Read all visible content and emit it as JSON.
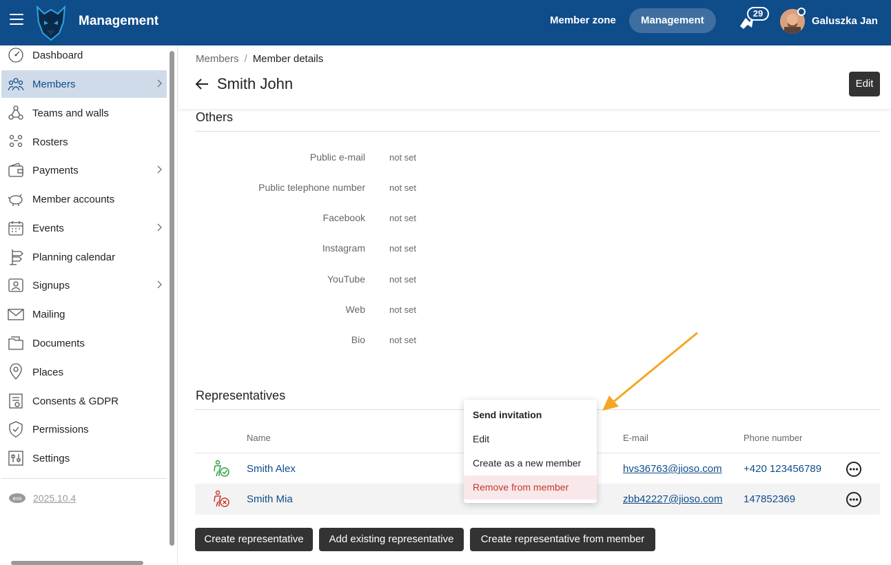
{
  "header": {
    "app_title": "Management",
    "nav": {
      "member_zone": "Member zone",
      "management": "Management"
    },
    "notification_count": "29",
    "user_name": "Galuszka Jan"
  },
  "sidebar": {
    "items": [
      {
        "label": "Dashboard",
        "icon": "dashboard-icon"
      },
      {
        "label": "Members",
        "icon": "members-icon",
        "active": true,
        "has_children": true
      },
      {
        "label": "Teams and walls",
        "icon": "teams-icon"
      },
      {
        "label": "Rosters",
        "icon": "rosters-icon"
      },
      {
        "label": "Payments",
        "icon": "payments-icon",
        "has_children": true
      },
      {
        "label": "Member accounts",
        "icon": "piggy-bank-icon"
      },
      {
        "label": "Events",
        "icon": "calendar-icon",
        "has_children": true
      },
      {
        "label": "Planning calendar",
        "icon": "signpost-icon"
      },
      {
        "label": "Signups",
        "icon": "signup-icon",
        "has_children": true
      },
      {
        "label": "Mailing",
        "icon": "mail-icon"
      },
      {
        "label": "Documents",
        "icon": "folder-icon"
      },
      {
        "label": "Places",
        "icon": "location-icon"
      },
      {
        "label": "Consents & GDPR",
        "icon": "consent-icon"
      },
      {
        "label": "Permissions",
        "icon": "shield-icon"
      },
      {
        "label": "Settings",
        "icon": "settings-icon"
      }
    ],
    "version_badge": "eos",
    "version": "2025.10.4"
  },
  "page": {
    "breadcrumb": {
      "parent": "Members",
      "separator": "/",
      "current": "Member details"
    },
    "title": "Smith John",
    "edit_label": "Edit"
  },
  "others": {
    "title": "Others",
    "fields": [
      {
        "label": "Public e-mail",
        "value": "not set"
      },
      {
        "label": "Public telephone number",
        "value": "not set"
      },
      {
        "label": "Facebook",
        "value": "not set"
      },
      {
        "label": "Instagram",
        "value": "not set"
      },
      {
        "label": "YouTube",
        "value": "not set"
      },
      {
        "label": "Web",
        "value": "not set"
      },
      {
        "label": "Bio",
        "value": "not set"
      }
    ]
  },
  "representatives": {
    "title": "Representatives",
    "columns": {
      "name": "Name",
      "email": "E-mail",
      "phone": "Phone number"
    },
    "rows": [
      {
        "name": "Smith Alex",
        "email": "hvs36763@jioso.com",
        "phone": "+420 123456789",
        "status": "accepted",
        "status_color": "#2e9e44"
      },
      {
        "name": "Smith Mia",
        "email": "zbb42227@jioso.com",
        "phone": "147852369",
        "status": "rejected",
        "status_color": "#c0392b"
      }
    ],
    "menu": [
      "Send invitation",
      "Edit",
      "Create as a new member",
      "Remove from member"
    ],
    "buttons": [
      "Create representative",
      "Add existing representative",
      "Create representative from member"
    ]
  },
  "colors": {
    "brand": "#0f4c8a",
    "annotation_arrow": "#f5a623",
    "danger": "#c0392b"
  }
}
